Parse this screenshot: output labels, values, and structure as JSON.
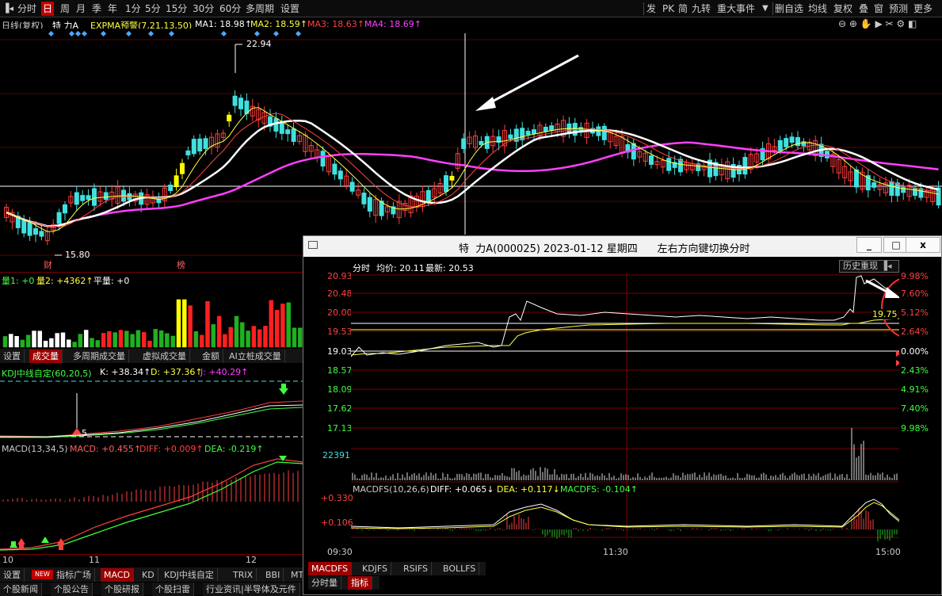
{
  "toolbar": {
    "left_items": [
      "分时",
      "日",
      "周",
      "月",
      "季",
      "年",
      "1分",
      "5分",
      "15分",
      "30分",
      "60分",
      "多周期",
      "设置"
    ],
    "active_left": "日",
    "right_items": [
      "发",
      "PK",
      "简",
      "九转",
      "重大事件",
      "删自选",
      "均线",
      "复权",
      "叠",
      "窗",
      "预测",
      "更多"
    ],
    "dropdown_glyph": "▼"
  },
  "kline": {
    "header": {
      "period": "日线(复权)",
      "stock": "特 力A",
      "indicator": "EXPMA预警(7,21,13,50)",
      "ma1": "MA1: 18.98↑",
      "ma2": "MA2: 18.59↑",
      "ma3": "MA3: 18.63↑",
      "ma4": "MA4: 18.69↑"
    },
    "high_label": "22.94",
    "low_label": "15.80",
    "marker_cai": "财",
    "marker_bang": "榜"
  },
  "volume": {
    "label1": "量1: +0",
    "label2": "量2: +4362↑",
    "label3": "平量: +0"
  },
  "tabs_mid": [
    "设置",
    "成交量",
    "多周期成交量",
    "虚拟成交量",
    "金额",
    "AI立桩成交量"
  ],
  "tabs_mid_active": "成交量",
  "kdj": {
    "title": "KDJ中线自定(60,20,5)",
    "k": "K: +38.34↑",
    "d": "D: +37.36↑",
    "j": "J: +40.29↑",
    "mark": "5"
  },
  "macd": {
    "title": "MACD(13,34,5)",
    "macd": "MACD: +0.455↑",
    "diff": "DIFF: +0.009↑",
    "dea": "DEA: -0.219↑"
  },
  "date_axis": [
    "10",
    "11",
    "12"
  ],
  "bottom_tabs": [
    "设置",
    "NEW",
    "指标广场",
    "MACD",
    "KD",
    "KDJ中线自定",
    "TRIX",
    "BBI",
    "MT"
  ],
  "bottom_tabs_active": "MACD",
  "news_tabs": [
    "个股新闻",
    "个股公告",
    "个股研报",
    "个股扫雷",
    "行业资讯|半导体及元件"
  ],
  "intraday": {
    "title": "特  力A(000025) 2023-01-12 星期四      左右方向键切换分时",
    "window_buttons": [
      "_",
      "□",
      "x"
    ],
    "info": {
      "label": "分时",
      "avg": "均价: 20.11",
      "last": "最新: 20.53"
    },
    "history_button": "历史重现",
    "price_labels": [
      "20.93",
      "20.48",
      "20.00",
      "19.53",
      "19.03",
      "18.57",
      "18.09",
      "17.62",
      "17.13"
    ],
    "pct_labels": [
      "9.98%",
      "7.60%",
      "5.12%",
      "2.64%",
      "0.00%",
      "2.43%",
      "4.91%",
      "7.40%",
      "9.98%"
    ],
    "current_tag": "19.75",
    "volume_max": "22391",
    "macdfs": {
      "title": "MACDFS(10,26,6)",
      "diff": "DIFF: +0.065↓",
      "dea": "DEA: +0.117↓",
      "val": "MACDFS: -0.104↑",
      "levels": [
        "+0.330",
        "+0.106"
      ]
    },
    "time_labels": [
      "09:30",
      "11:30",
      "15:00"
    ],
    "tabs": [
      "MACDFS",
      "KDJFS",
      "RSIFS",
      "BOLLFS"
    ],
    "tabs_active": "MACDFS",
    "sub_tabs": [
      "分时量",
      "指标"
    ],
    "sub_tabs_active": "指标"
  },
  "colors": {
    "up": "#ff3c3c",
    "down": "#40e0e0",
    "ma_white": "#ffffff",
    "ma_yellow": "#ffff40",
    "ma_red": "#ff4040",
    "ma_magenta": "#ff40ff",
    "accent": "#c00000"
  }
}
